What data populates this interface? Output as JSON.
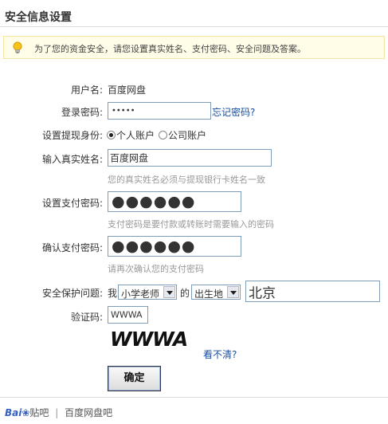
{
  "page": {
    "title": "安全信息设置"
  },
  "notice": {
    "text": "为了您的资金安全，请您设置真实姓名、支付密码、安全问题及答案。"
  },
  "form": {
    "username_label": "用户名:",
    "username_value": "百度网盘",
    "login_pw_label": "登录密码:",
    "login_pw_value": "•••••",
    "forgot_link": "忘记密码?",
    "identity_label": "设置提现身份:",
    "identity_options": [
      "个人账户",
      "公司账户"
    ],
    "identity_selected": "个人账户",
    "realname_label": "输入真实姓名:",
    "realname_value": "百度网盘",
    "realname_hint": "您的真实姓名必须与提现银行卡姓名一致",
    "paypw_label": "设置支付密码:",
    "paypw_value": "●●●●●●",
    "paypw_hint": "支付密码是要付款或转账时需要输入的密码",
    "confirm_label": "确认支付密码:",
    "confirm_value": "●●●●●●",
    "confirm_hint": "请再次确认您的支付密码",
    "question_label": "安全保护问题:",
    "question_prefix": "我",
    "question_select1": "小学老师",
    "question_mid": "的",
    "question_select2": "出生地",
    "question_answer": "北京",
    "captcha_label": "验证码:",
    "captcha_input": "WWWA",
    "captcha_image_text": "WWWA",
    "captcha_refresh": "看不清?",
    "submit_label": "确定"
  },
  "footer": {
    "logo_text": "Bai",
    "logo_suffix": "贴吧",
    "divider": "|",
    "forum_name": "百度网盘吧"
  }
}
